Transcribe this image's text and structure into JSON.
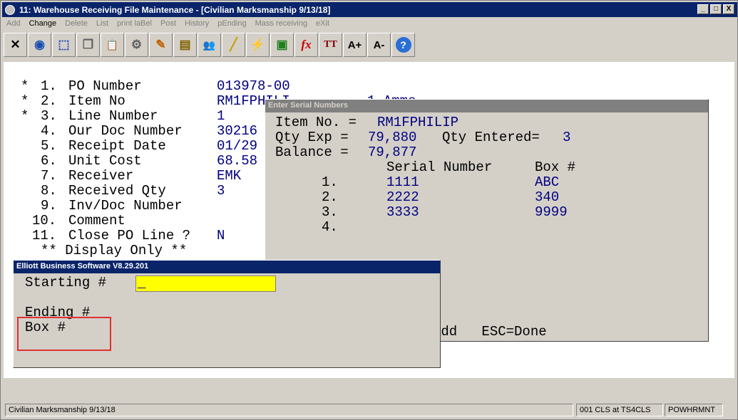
{
  "window": {
    "title": "11: Warehouse Receiving File Maintenance - [Civilian Marksmanship 9/13/18]",
    "buttons": {
      "minimize": "_",
      "maximize": "□",
      "close": "X"
    }
  },
  "menu": [
    "Add",
    "Change",
    "Delete",
    "List",
    "print laBel",
    "Post",
    "History",
    "pEnding",
    "Mass receiving",
    "eXit"
  ],
  "toolbar": {
    "icons": [
      "close-icon",
      "globe-icon",
      "select-icon",
      "copy-icon",
      "paste-icon",
      "settings-icon",
      "edit-icon",
      "notes-icon",
      "users-icon",
      "ruler-icon",
      "lightning-icon",
      "window-icon",
      "function-icon",
      "font-size-icon",
      "font-increase-icon",
      "font-decrease-icon",
      "help-icon"
    ],
    "glyphs": [
      "✕",
      "◉",
      "⬚",
      "❐",
      "📋",
      "⚙",
      "✎",
      "▤",
      "👥",
      "╱",
      "⚡",
      "▣",
      "fx",
      "TT",
      "A+",
      "A-",
      "?"
    ]
  },
  "form": {
    "fields": [
      {
        "mark": "*",
        "num": "1.",
        "label": "PO Number",
        "value": "013978-00"
      },
      {
        "mark": "*",
        "num": "2.",
        "label": "Item No",
        "value": "RM1FPHILI"
      },
      {
        "mark": "*",
        "num": "3.",
        "label": "Line Number",
        "value": "1"
      },
      {
        "mark": "",
        "num": "4.",
        "label": "Our Doc Number",
        "value": "30216"
      },
      {
        "mark": "",
        "num": "5.",
        "label": "Receipt Date",
        "value": "01/29"
      },
      {
        "mark": "",
        "num": "6.",
        "label": "Unit Cost",
        "value": "68.58"
      },
      {
        "mark": "",
        "num": "7.",
        "label": "Receiver",
        "value": "EMK"
      },
      {
        "mark": "",
        "num": "8.",
        "label": "Received Qty",
        "value": "3"
      },
      {
        "mark": "",
        "num": "9.",
        "label": "Inv/Doc Number",
        "value": ""
      },
      {
        "mark": "",
        "num": "10.",
        "label": "Comment",
        "value": ""
      },
      {
        "mark": "",
        "num": "11.",
        "label": "Close PO Line ?",
        "value": "N"
      }
    ],
    "display_only": "** Display Only **",
    "item_desc_partial": "1 Ammo"
  },
  "serial_dialog": {
    "title": "Enter Serial Numbers",
    "item_label": "Item No. =",
    "item_value": "RM1FPHILIP",
    "qty_exp_label": "Qty Exp =",
    "qty_exp_value": "79,880",
    "qty_entered_label": "Qty Entered=",
    "qty_entered_value": "3",
    "balance_label": "Balance =",
    "balance_value": "79,877",
    "col_serial": "Serial Number",
    "col_box": "Box #",
    "rows": [
      {
        "num": "1.",
        "serial": "1111",
        "box": "ABC"
      },
      {
        "num": "2.",
        "serial": "2222",
        "box": "340"
      },
      {
        "num": "3.",
        "serial": "3333",
        "box": "9999"
      },
      {
        "num": "4.",
        "serial": "",
        "box": ""
      }
    ],
    "footer": "Add   ESC=Done"
  },
  "elliott_dialog": {
    "title": "Elliott Business Software V8.29.201",
    "starting_label": "Starting #",
    "starting_value": "_",
    "ending_label": "Ending #",
    "box_label": "Box #"
  },
  "status": {
    "company": "Civilian Marksmanship 9/13/18",
    "session": "001 CLS at TS4CLS",
    "user": "POWHRMNT"
  },
  "colors": {
    "title_bg": "#0a246a",
    "field_value": "#000080",
    "highlight_input": "#ffff00",
    "annotation_box": "#e03030"
  }
}
